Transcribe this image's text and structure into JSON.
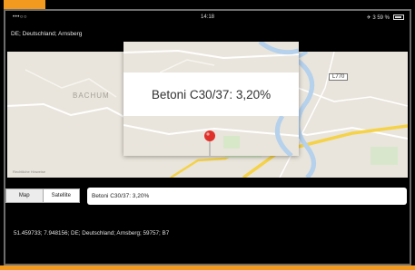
{
  "status_bar": {
    "carrier": "•••○○ ",
    "time": "14:18",
    "battery_text": "✈ 3 59 %"
  },
  "location_line": "DE; Deutschland; Arnsberg",
  "map": {
    "labels": [
      "BACHUM",
      "L770"
    ],
    "attribution": "Rechtliche Hinweise"
  },
  "popup": {
    "title": "Betoni C30/37: 3,20%"
  },
  "segmented_control": {
    "options": [
      "Map",
      "Satellite"
    ],
    "selected": "Map"
  },
  "search_field": {
    "value": "Betoni C30/37: 3,20%"
  },
  "coordinates_line": "51.459733; 7.948156; DE; Deutschland; Arnsberg; 59757; B7",
  "colors": {
    "accent": "#f29a1f",
    "pin": "#e0302a",
    "river": "#b5d1ec",
    "road_yellow": "#f5d247"
  }
}
